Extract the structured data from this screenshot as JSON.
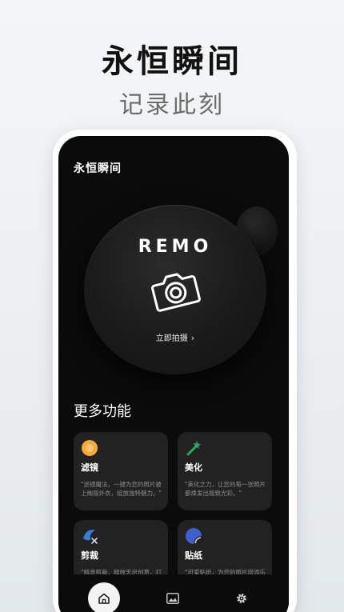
{
  "headline": "永恒瞬间",
  "subline": "记录此刻",
  "app": {
    "title": "永恒瞬间",
    "brand": "REMO",
    "shoot_label": "立即拍摄",
    "shoot_chevron": "›"
  },
  "section": {
    "title": "更多功能"
  },
  "features": [
    {
      "title": "滤镜",
      "desc": "\"滤镜魔法，一键为您的照片披上绚丽外衣，绽放独特魅力。\"",
      "icon": "filter-icon",
      "color": "#f2a93b"
    },
    {
      "title": "美化",
      "desc": "\"美化之力，让您的每一张照片都焕发出极致光彩。\"",
      "icon": "magic-wand-icon",
      "color": "#2fa36b"
    },
    {
      "title": "剪裁",
      "desc": "\"精准剪裁，释放无尽创意，打造完美构图。\"",
      "icon": "crop-icon",
      "color": "#3b7bd9"
    },
    {
      "title": "贴纸",
      "desc": "\"可爱贴纸，为您的照片增添乐趣与个性。\"",
      "icon": "sticker-icon",
      "color": "#3f5fd1"
    }
  ],
  "tabs": [
    {
      "name": "home",
      "icon": "home-icon",
      "active": true
    },
    {
      "name": "gallery",
      "icon": "image-icon",
      "active": false
    },
    {
      "name": "settings",
      "icon": "gear-icon",
      "active": false
    }
  ],
  "colors": {
    "screen_bg": "#0b0b0b",
    "card_bg": "#222222",
    "accent_white": "#ffffff"
  }
}
